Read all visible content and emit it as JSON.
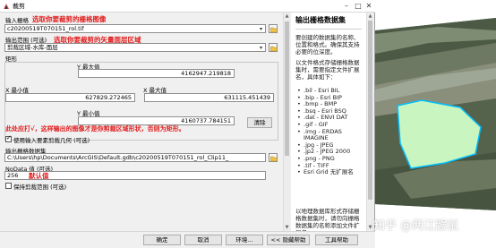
{
  "window": {
    "title": "裁剪"
  },
  "fields": {
    "input_raster": {
      "label": "输入栅格",
      "value": "c20200519T070151_rol.tif",
      "annotation": "选取你要裁剪的栅格图像"
    },
    "output_extent": {
      "label": "输出范围 (可选)",
      "value": "剪裁区域-水库-面层",
      "annotation": "选取你要裁剪的矢量面层区域"
    },
    "rectangle": {
      "label": "矩形"
    },
    "y_max": {
      "label": "Y 最大值",
      "value": "4162947.219818"
    },
    "x_min": {
      "label": "X 最小值",
      "value": "627829.272465"
    },
    "x_max": {
      "label": "X 最大值",
      "value": "631115.451439"
    },
    "y_min": {
      "label": "Y 最小值",
      "value": "4160737.784151"
    },
    "clear_label": "清除",
    "use_geometry": {
      "label": "使用输入要素剪裁几何 (可选)",
      "checked": true,
      "annotation": "此处应打√，这样输出的图像才是你剪裁区域形状，否则为矩形。"
    },
    "output_raster": {
      "label": "输出栅格数据集",
      "value": "C:\\Users\\hp\\Documents\\ArcGIS\\Default.gdb\\c20200519T070151_rol_Clip11_"
    },
    "nodata": {
      "label": "NoData 值 (可选)",
      "value": "256",
      "annotation": "默认值"
    },
    "maintain_extent": {
      "label": "保持剪裁范围 (可选)",
      "checked": false
    }
  },
  "help": {
    "title": "输出栅格数据集",
    "para1": "要创建的数据集的名称、位置和格式。确保其支持必要的位深度。",
    "para2": "以文件格式存储栅格数据集时，需要指定文件扩展名，具体如下：",
    "formats": [
      ".bil - Esri BIL",
      ".bip - Esri BIP",
      ".bmp - BMP",
      ".bsq - Esri BSQ",
      ".dat - ENVI DAT",
      ".gif - GIF",
      ".img - ERDAS IMAGINE",
      ".jpg - JPEG",
      ".jp2 - JPEG 2000",
      ".png - PNG",
      ".tif - TIFF",
      "Esri Grid 无扩展名"
    ],
    "para3": "以地理数据库形式存储栅格数据集时，请勿向栅格数据集的名称添加文件扩展名。"
  },
  "buttons": {
    "ok": "确定",
    "cancel": "取消",
    "environments": "环境...",
    "hide_help": "<< 隐藏帮助",
    "tool_help": "工具帮助"
  },
  "watermark": "知乎 @两江鼹鼠",
  "colors": {
    "annotation": "#e11c1c",
    "polygon_fill": "#c8f5c0",
    "polygon_stroke": "#00c0ff"
  }
}
